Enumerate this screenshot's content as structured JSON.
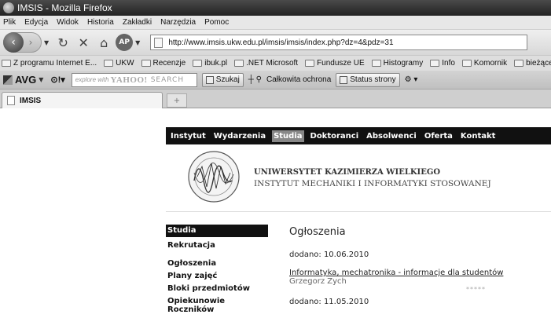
{
  "window": {
    "title": "IMSIS - Mozilla Firefox"
  },
  "menu": [
    "Plik",
    "Edycja",
    "Widok",
    "Historia",
    "Zakładki",
    "Narzędzia",
    "Pomoc"
  ],
  "nav": {
    "back_glyph": "‹",
    "fwd_glyph": "›",
    "url": "http://www.imsis.ukw.edu.pl/imsis/imsis/index.php?dz=4&pdz=31",
    "badge": "AP"
  },
  "bookmarks": [
    "Z programu Internet E...",
    "UKW",
    "Recenzje",
    "ibuk.pl",
    ".NET Microsoft",
    "Fundusze UE",
    "Histogramy",
    "Info",
    "Komornik",
    "bieżące OOP i bazy"
  ],
  "avg": {
    "brand": "AVG",
    "search_prefix": "explore with",
    "search_brand": "YAHOO!",
    "search_label": "SEARCH",
    "search_button": "Szukaj",
    "protection": "Całkowita ochrona",
    "status_button": "Status strony"
  },
  "tab": {
    "label": "IMSIS",
    "new_tab_glyph": "+"
  },
  "site": {
    "nav": [
      "Instytut",
      "Wydarzenia",
      "Studia",
      "Doktoranci",
      "Absolwenci",
      "Oferta",
      "Kontakt"
    ],
    "active_nav": "Studia",
    "university": "UNIWERSYTET KAZIMIERZA WIELKIEGO",
    "institute": "INSTYTUT MECHANIKI I INFORMATYKI STOSOWANEJ",
    "sidebar_head": "Studia",
    "sidebar_items": [
      "Rekrutacja",
      "Ogłoszenia",
      "Plany zajęć",
      "Bloki przedmiotów",
      "Opiekunowie Roczników"
    ],
    "heading": "Ogłoszenia",
    "posts": [
      {
        "date": "dodano: 10.06.2010",
        "title": "Informatyka, mechatronika - informacje dla studentów",
        "author": "Grzegorz Zych",
        "stars": "*****"
      },
      {
        "date": "dodano: 11.05.2010"
      }
    ]
  }
}
